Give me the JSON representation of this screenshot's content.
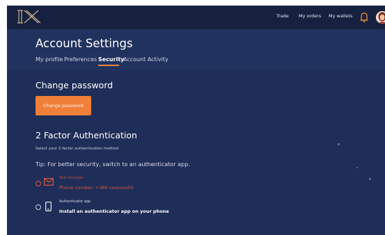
{
  "colors": {
    "background": "#1f2e58",
    "topbar": "#16213f",
    "accent_orange": "#f07f3a",
    "sms_red": "#e0563c",
    "text_white": "#ffffff"
  },
  "topbar": {
    "logo_text": "IX",
    "nav": [
      "Trade",
      "My orders",
      "My wallets"
    ],
    "icons": [
      "bell-icon",
      "avatar"
    ]
  },
  "header": {
    "title": "Account Settings",
    "tabs": [
      {
        "label": "My profile",
        "active": false
      },
      {
        "label": "Preferences",
        "active": false
      },
      {
        "label": "Security",
        "active": true
      },
      {
        "label": "Account Activity",
        "active": false
      }
    ]
  },
  "change_password": {
    "title": "Change password",
    "button_label": "Change password"
  },
  "two_factor": {
    "title": "2 Factor Authentication",
    "subtitle": "Select your 2-factor authentication method",
    "tip": "Tip: For better security, switch to an authenticator app.",
    "options": [
      {
        "icon": "envelope-icon",
        "title": "Text message",
        "detail": "Phone number: +380 xxxxxxx00",
        "selected": true
      },
      {
        "icon": "phone-icon",
        "title": "Authenticator app",
        "detail": "Install an authenticator app on your phone",
        "selected": false
      }
    ]
  }
}
